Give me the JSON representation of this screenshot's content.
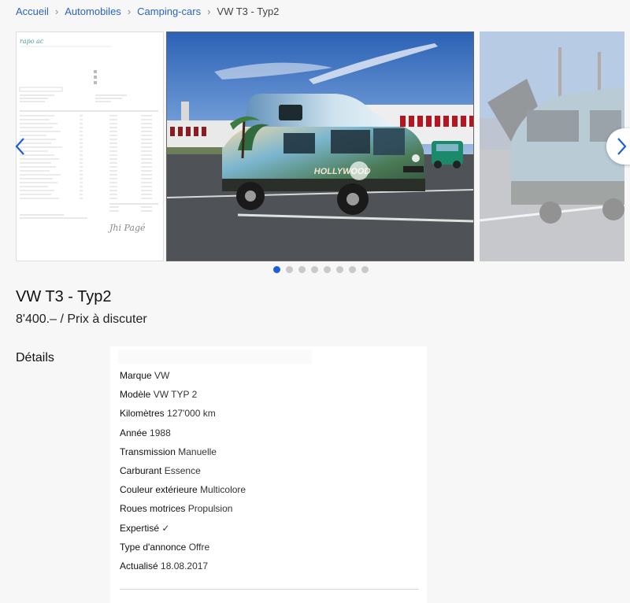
{
  "breadcrumb": {
    "items": [
      "Accueil",
      "Automobiles",
      "Camping-cars"
    ],
    "current": "VW T3 - Typ2"
  },
  "carousel": {
    "slide_count": 8,
    "active_index": 0,
    "doc_logo": "rapo ac",
    "main_image_text": "HOLLYWOOD",
    "doc_signature": "Jhi Pagé",
    "colors": {
      "dot_active": "#1f5fd6",
      "dot_inactive": "#c9c9cc",
      "link": "#2a63c5"
    }
  },
  "listing": {
    "title": "VW T3 - Typ2",
    "price": "8'400.– / Prix à discuter"
  },
  "details": {
    "heading": "Détails",
    "rows": [
      {
        "key": "Marque",
        "value": "VW"
      },
      {
        "key": "Modèle",
        "value": "VW TYP 2"
      },
      {
        "key": "Kilomètres",
        "value": "127'000 km"
      },
      {
        "key": "Année",
        "value": "1988"
      },
      {
        "key": "Transmission",
        "value": "Manuelle"
      },
      {
        "key": "Carburant",
        "value": "Essence"
      },
      {
        "key": "Couleur extérieure",
        "value": "Multicolore"
      },
      {
        "key": "Roues motrices",
        "value": "Propulsion"
      },
      {
        "key": "Expertisé",
        "value": "✓"
      },
      {
        "key": "Type d'annonce",
        "value": "Offre"
      },
      {
        "key": "Actualisé",
        "value": "18.08.2017"
      }
    ]
  }
}
